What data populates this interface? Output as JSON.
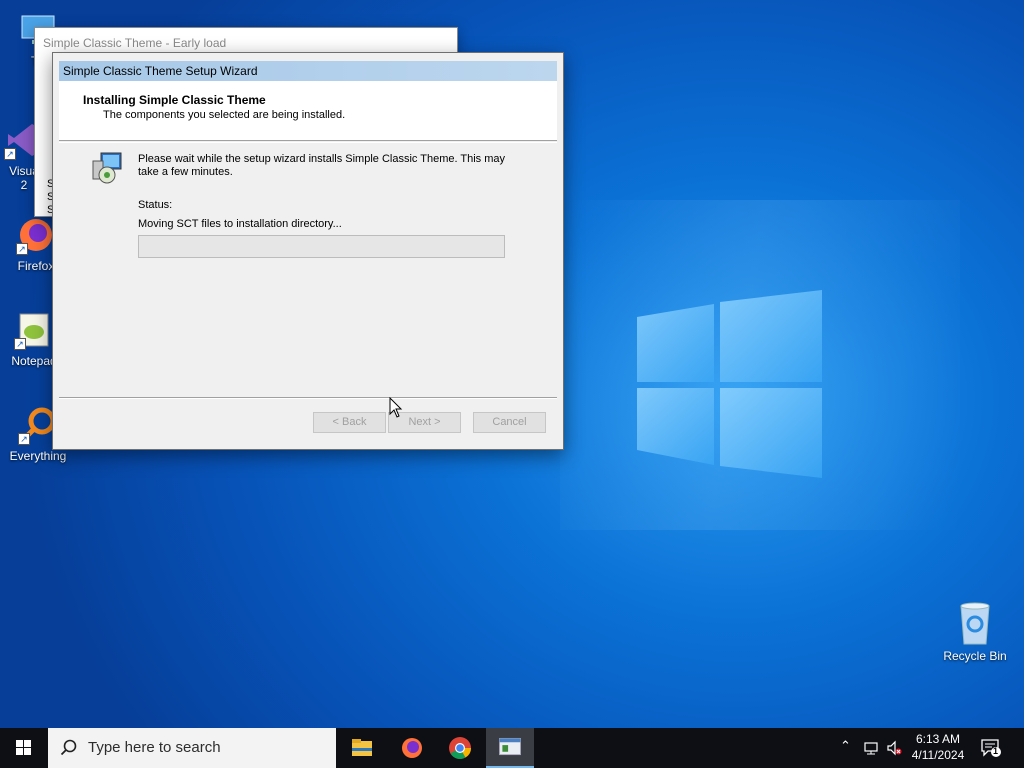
{
  "desktop": {
    "icons": [
      {
        "label": "Th"
      },
      {
        "label": "Visua\n2"
      },
      {
        "label": "Firefox"
      },
      {
        "label": "Notepad"
      },
      {
        "label": "Everything"
      }
    ],
    "recycle_bin": {
      "label": "Recycle Bin"
    }
  },
  "back_window": {
    "title": "Simple Classic Theme - Early load",
    "side_text": "S\nS\nS"
  },
  "wizard": {
    "title": "Simple Classic Theme Setup Wizard",
    "header_title": "Installing Simple Classic Theme",
    "header_subtitle": "The components you selected are being installed.",
    "body_text": "Please wait while the setup wizard installs Simple Classic Theme. This may take a few minutes.",
    "status_label": "Status:",
    "status_text": "Moving SCT files to installation directory...",
    "progress_percent": 0,
    "buttons": {
      "back": "< Back",
      "next": "Next >",
      "cancel": "Cancel"
    }
  },
  "taskbar": {
    "search_placeholder": "Type here to search",
    "clock_time": "6:13 AM",
    "clock_date": "4/11/2024",
    "notification_count": "1",
    "accent_color": "#76b9ed"
  }
}
